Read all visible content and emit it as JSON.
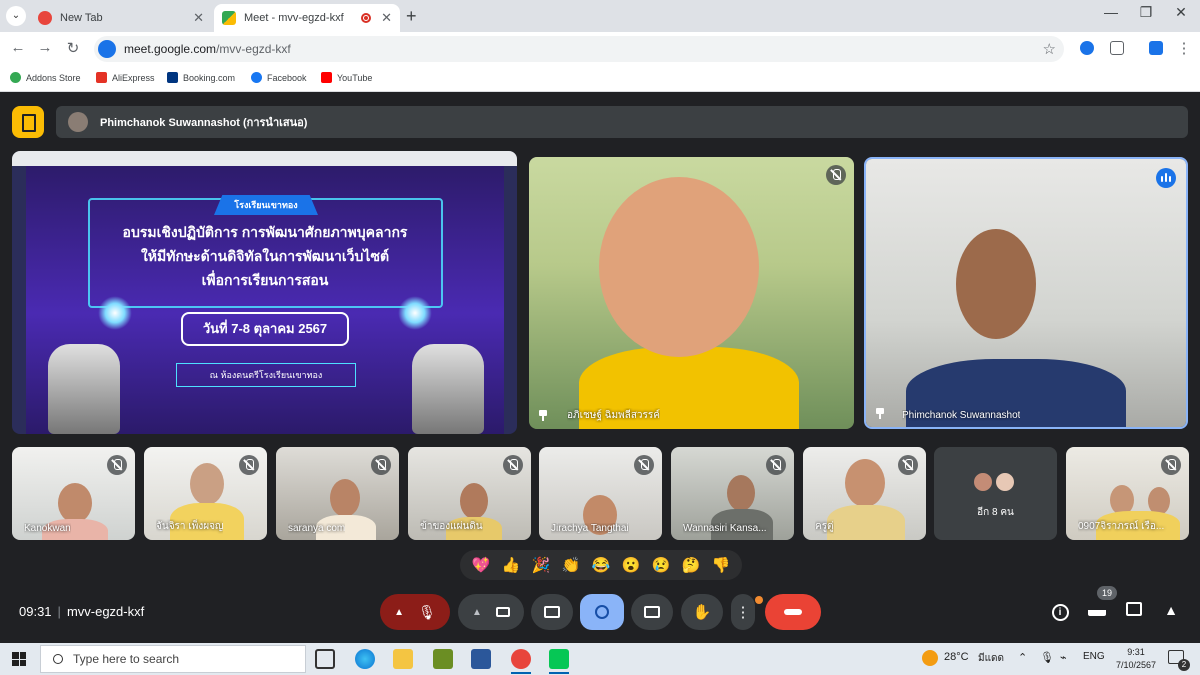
{
  "browser": {
    "tabs": [
      {
        "title": "New Tab",
        "active": false
      },
      {
        "title": "Meet - mvv-egzd-kxf",
        "active": true
      }
    ],
    "url_host": "meet.google.com",
    "url_path": "/mvv-egzd-kxf",
    "bookmarks": [
      "Addons Store",
      "AliExpress",
      "Booking.com",
      "Facebook",
      "YouTube"
    ]
  },
  "meet": {
    "presenter": "Phimchanok Suwannashot (การนำเสนอ)",
    "slide": {
      "banner": "โรงเรียนเขาทอง",
      "line1": "อบรมเชิงปฏิบัติการ การพัฒนาศักยภาพบุคลากร",
      "line2": "ให้มีทักษะด้านดิจิทัลในการพัฒนาเว็บไซต์",
      "line3": "เพื่อการเรียนการสอน",
      "date": "วันที่ 7-8 ตุลาคม 2567",
      "location": "ณ ห้องดนตรีโรงเรียนเขาทอง"
    },
    "main_tiles": [
      {
        "name": "อภิเชษฐ์ ฉิมพลีสวรรค์",
        "muted": true
      },
      {
        "name": "Phimchanok Suwannashot",
        "speaking": true
      }
    ],
    "participants": [
      {
        "name": "Kanokwan"
      },
      {
        "name": "จันจิรา เพ็งผจญ"
      },
      {
        "name": "saranya com"
      },
      {
        "name": "ข้าของแผ่นดิน"
      },
      {
        "name": "Jirachya Tangthai"
      },
      {
        "name": "Wannasiri Kansa..."
      },
      {
        "name": "ครูตู่"
      },
      {
        "name": "อีก 8 คน"
      },
      {
        "name": "0907จิราภรณ์ เรือ..."
      }
    ],
    "reactions": [
      "💖",
      "👍",
      "🎉",
      "👏",
      "😂",
      "😮",
      "😢",
      "🤔",
      "👎"
    ],
    "time": "09:31",
    "meeting_code": "mvv-egzd-kxf",
    "people_count": "19"
  },
  "taskbar": {
    "search_placeholder": "Type here to search",
    "weather": "28°C",
    "weather_desc": "มีแดด",
    "lang": "ENG",
    "time": "9:31",
    "date": "7/10/2567",
    "notification_count": "2"
  }
}
